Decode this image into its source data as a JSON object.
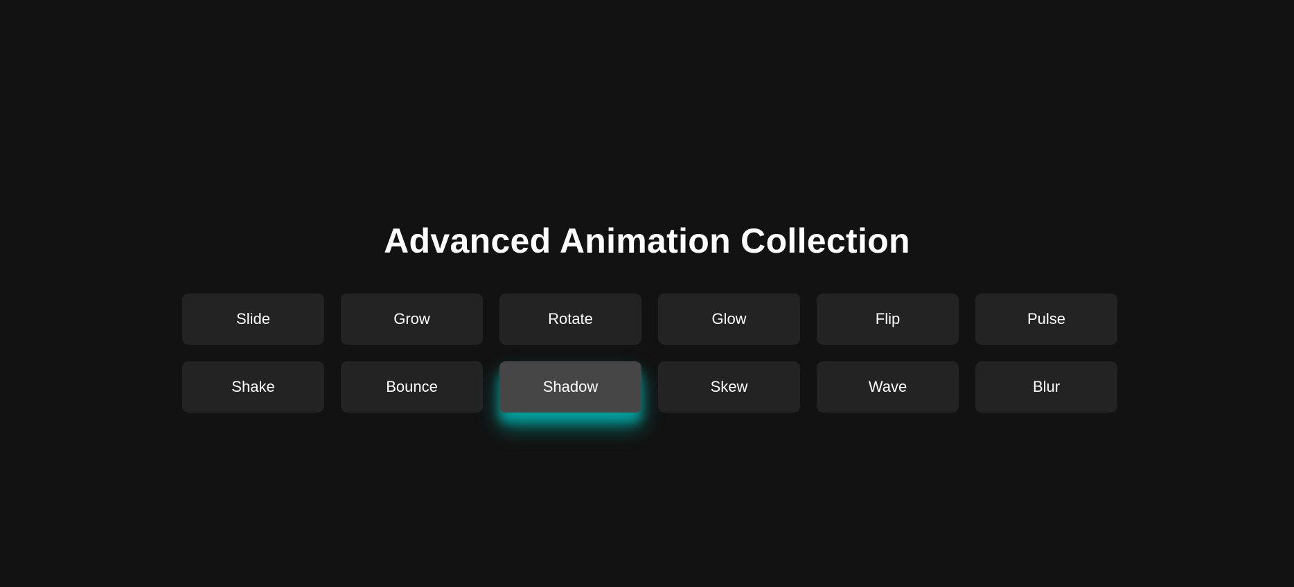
{
  "page": {
    "title": "Advanced Animation Collection"
  },
  "buttons": [
    {
      "label": "Slide"
    },
    {
      "label": "Grow"
    },
    {
      "label": "Rotate"
    },
    {
      "label": "Glow"
    },
    {
      "label": "Flip"
    },
    {
      "label": "Pulse"
    },
    {
      "label": "Shake"
    },
    {
      "label": "Bounce"
    },
    {
      "label": "Shadow",
      "state": "hover"
    },
    {
      "label": "Skew"
    },
    {
      "label": "Wave"
    },
    {
      "label": "Blur"
    }
  ],
  "colors": {
    "background": "#121212",
    "button": "#232323",
    "button_active": "#464646",
    "glow_accent": "#00cec9",
    "text": "#ffffff"
  }
}
